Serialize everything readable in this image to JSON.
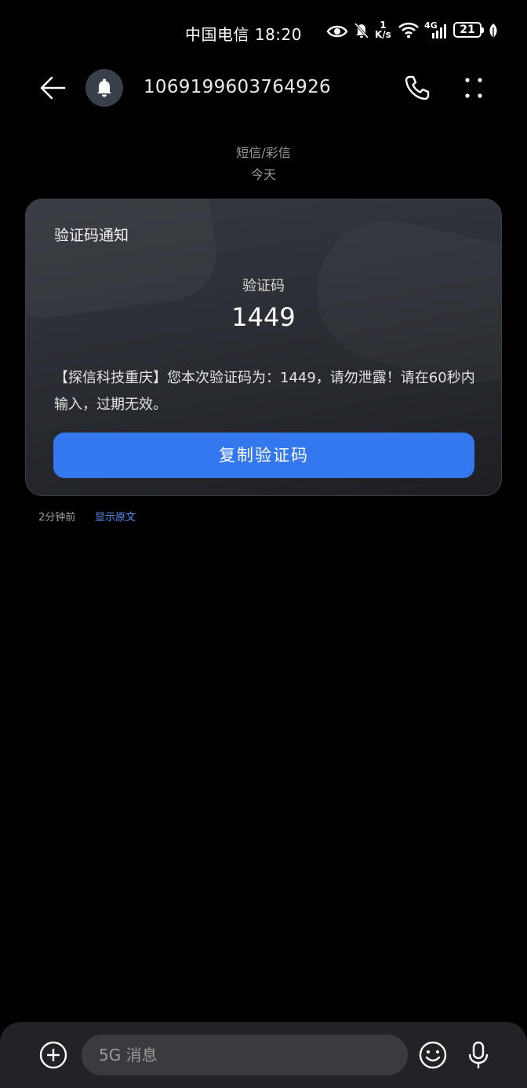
{
  "status_bar": {
    "carrier_time": "中国电信 18:20",
    "net_speed_value": "1",
    "net_speed_unit": "K/s",
    "network": "4G",
    "battery": "21"
  },
  "header": {
    "contact": "1069199603764926"
  },
  "separator": {
    "type": "短信/彩信",
    "date": "今天"
  },
  "card": {
    "title": "验证码通知",
    "code_label": "验证码",
    "code_value": "1449",
    "body": "【探信科技重庆】您本次验证码为：1449，请勿泄露！请在60秒内输入，过期无效。",
    "copy_button": "复制验证码"
  },
  "meta": {
    "time": "2分钟前",
    "show_original": "显示原文"
  },
  "composer": {
    "placeholder": "5G 消息"
  },
  "colors": {
    "accent": "#3478f0",
    "link": "#5d8ff5",
    "background": "#000000"
  }
}
